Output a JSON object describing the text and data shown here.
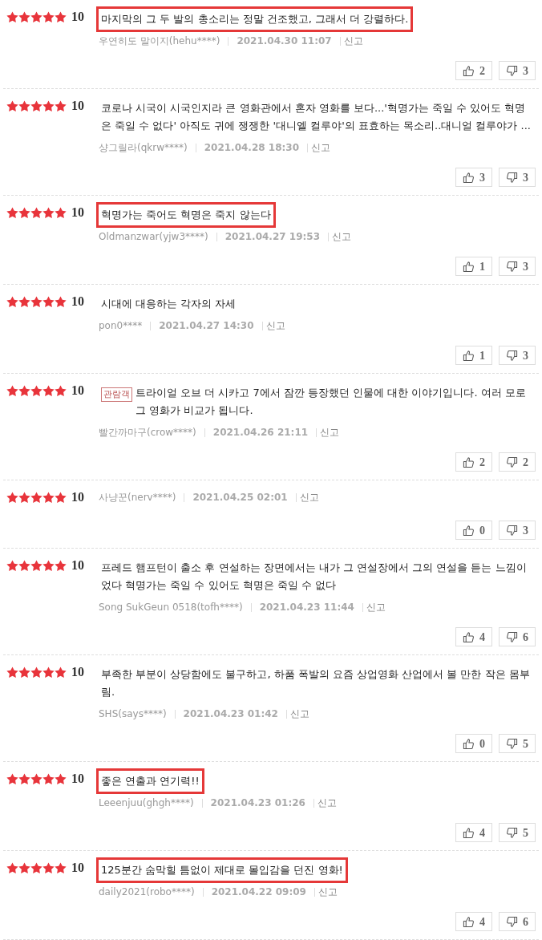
{
  "reviews": [
    {
      "stars": 5,
      "score": "10",
      "text": "마지막의 그 두 발의 총소리는 정말 건조했고, 그래서 더 강렬하다.",
      "highlighted": true,
      "author": "우연히도 말이지(hehu****)",
      "date": "2021.04.30 11:07",
      "report": "신고",
      "likes": "2",
      "dislikes": "3"
    },
    {
      "stars": 5,
      "score": "10",
      "text": "코로나 시국이 시국인지라 큰 영화관에서 혼자 영화를 보다...'혁명가는 죽일 수 있어도 혁명은 죽일 수 없다' 아직도 귀에 쟁쟁한 '대니엘 컬루야'의 표효하는 목소리..대니얼 컬루야가 ...",
      "highlighted": false,
      "author": "샹그릴라(qkrw****)",
      "date": "2021.04.28 18:30",
      "report": "신고",
      "likes": "3",
      "dislikes": "3"
    },
    {
      "stars": 5,
      "score": "10",
      "text": "혁명가는 죽어도 혁명은 죽지 않는다",
      "highlighted": true,
      "author": "Oldmanzwar(yjw3****)",
      "date": "2021.04.27 19:53",
      "report": "신고",
      "likes": "1",
      "dislikes": "3"
    },
    {
      "stars": 5,
      "score": "10",
      "text": "시대에 대응하는 각자의 자세",
      "highlighted": false,
      "author": "pon0****",
      "date": "2021.04.27 14:30",
      "report": "신고",
      "likes": "1",
      "dislikes": "3"
    },
    {
      "stars": 5,
      "score": "10",
      "badge": "관람객",
      "text": "트라이얼 오브 더 시카고 7에서 잠깐 등장했던 인물에 대한 이야기입니다. 여러 모로 그 영화가 비교가 됩니다.",
      "highlighted": false,
      "author": "빨간까마구(crow****)",
      "date": "2021.04.26 21:11",
      "report": "신고",
      "likes": "2",
      "dislikes": "2"
    },
    {
      "stars": 5,
      "score": "10",
      "highlighted": false,
      "author": "사냥꾼(nerv****)",
      "date": "2021.04.25 02:01",
      "report": "신고",
      "likes": "0",
      "dislikes": "3"
    },
    {
      "stars": 5,
      "score": "10",
      "text": "프레드 햄프턴이 출소 후 연설하는 장면에서는 내가 그 연설장에서 그의 연설을 듣는 느낌이었다 혁명가는 죽일 수 있어도 혁명은 죽일 수 없다",
      "highlighted": false,
      "author": "Song SukGeun 0518(tofh****)",
      "date": "2021.04.23 11:44",
      "report": "신고",
      "likes": "4",
      "dislikes": "6"
    },
    {
      "stars": 5,
      "score": "10",
      "text": "부족한 부분이 상당함에도 불구하고, 하품 폭발의 요즘 상업영화 산업에서 볼 만한 작은 몸부림.",
      "highlighted": false,
      "author": "SHS(says****)",
      "date": "2021.04.23 01:42",
      "report": "신고",
      "likes": "0",
      "dislikes": "5"
    },
    {
      "stars": 5,
      "score": "10",
      "text": "좋은 연출과 연기력!!",
      "highlighted": true,
      "author": "Leeenjuu(ghgh****)",
      "date": "2021.04.23 01:26",
      "report": "신고",
      "likes": "4",
      "dislikes": "5"
    },
    {
      "stars": 5,
      "score": "10",
      "text": "125분간 숨막힐 틈없이 제대로 몰입감을 던진 영화!",
      "highlighted": true,
      "author": "daily2021(robo****)",
      "date": "2021.04.22 09:09",
      "report": "신고",
      "likes": "4",
      "dislikes": "6"
    }
  ]
}
